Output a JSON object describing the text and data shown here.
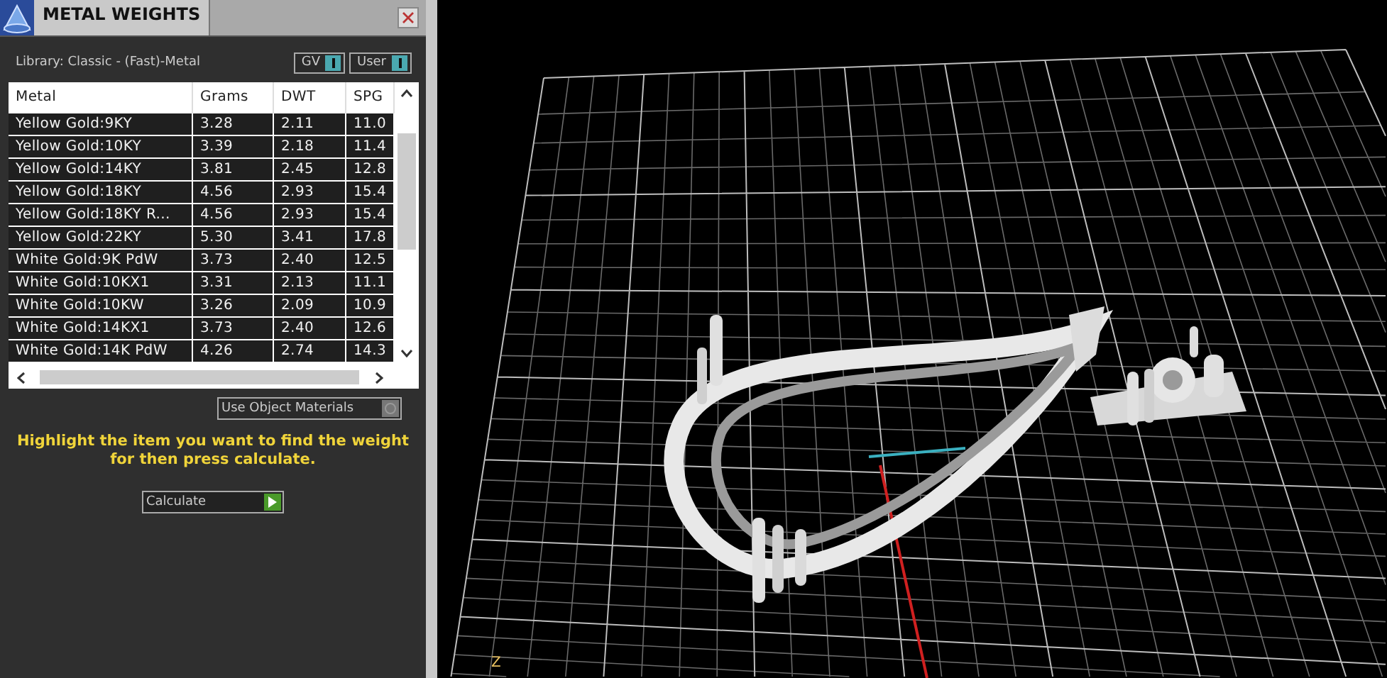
{
  "panel": {
    "title": "METAL WEIGHTS",
    "library": "Library: Classic - (Fast)-Metal",
    "toggles": [
      {
        "label": "GV",
        "on": true
      },
      {
        "label": "User",
        "on": true
      }
    ],
    "table": {
      "columns": [
        "Metal",
        "Grams",
        "DWT",
        "SPG"
      ],
      "rows": [
        {
          "cells": [
            "Yellow Gold:9KY",
            "3.28",
            "2.11",
            "11.0"
          ]
        },
        {
          "cells": [
            "Yellow Gold:10KY",
            "3.39",
            "2.18",
            "11.4"
          ]
        },
        {
          "cells": [
            "Yellow Gold:14KY",
            "3.81",
            "2.45",
            "12.8"
          ]
        },
        {
          "cells": [
            "Yellow Gold:18KY",
            "4.56",
            "2.93",
            "15.4"
          ]
        },
        {
          "cells": [
            "Yellow Gold:18KY R...",
            "4.56",
            "2.93",
            "15.4"
          ]
        },
        {
          "cells": [
            "Yellow Gold:22KY",
            "5.30",
            "3.41",
            "17.8"
          ]
        },
        {
          "cells": [
            "White Gold:9K PdW",
            "3.73",
            "2.40",
            "12.5"
          ]
        },
        {
          "cells": [
            "White Gold:10KX1",
            "3.31",
            "2.13",
            "11.1"
          ]
        },
        {
          "cells": [
            "White Gold:10KW",
            "3.26",
            "2.09",
            "10.9"
          ]
        },
        {
          "cells": [
            "White Gold:14KX1",
            "3.73",
            "2.40",
            "12.6"
          ]
        },
        {
          "cells": [
            "White Gold:14K PdW",
            "4.26",
            "2.74",
            "14.3"
          ]
        }
      ]
    },
    "use_object_materials": {
      "label": "Use Object Materials",
      "checked": false
    },
    "hint": "Highlight the item you want to find the weight for then press calculate.",
    "calculate": "Calculate"
  },
  "viewport": {
    "axis_label": "Z"
  }
}
